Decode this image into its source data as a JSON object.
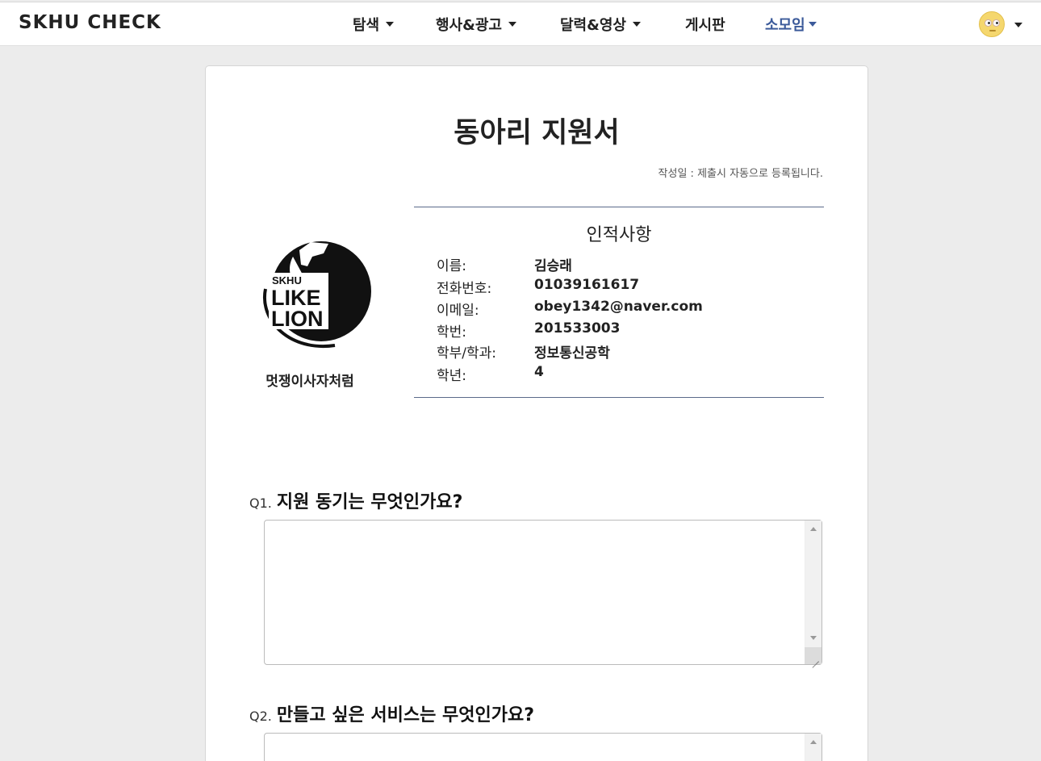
{
  "navbar": {
    "brand": "SKHU CHECK",
    "items": [
      {
        "label": "탐색",
        "dropdown": true
      },
      {
        "label": "행사&광고",
        "dropdown": true
      },
      {
        "label": "달력&영상",
        "dropdown": true
      },
      {
        "label": "게시판",
        "dropdown": false
      },
      {
        "label": "소모임",
        "dropdown": true,
        "active": true
      }
    ],
    "active_color": "#3b5a9a",
    "avatar_icon": "smiley-face-icon"
  },
  "form": {
    "title": "동아리 지원서",
    "written_date": "작성일 : 제출시 자동으로 등록됩니다.",
    "club": {
      "logo_text": [
        "SKHU",
        "LIKE",
        "LION"
      ],
      "name": "멋쟁이사자처럼"
    },
    "profile": {
      "heading": "인적사항",
      "rows": [
        {
          "key": "이름:",
          "value": "김승래"
        },
        {
          "key": "전화번호:",
          "value": "01039161617"
        },
        {
          "key": "이메일:",
          "value": "obey1342@naver.com"
        },
        {
          "key": "학번:",
          "value": "201533003"
        },
        {
          "key": "학부/학과:",
          "value": "정보통신공학"
        },
        {
          "key": "학년:",
          "value": "4"
        }
      ]
    },
    "questions": [
      {
        "number": "Q1.",
        "text": "지원 동기는 무엇인가요?",
        "answer": ""
      },
      {
        "number": "Q2.",
        "text": "만들고 싶은 서비스는 무엇인가요?",
        "answer": ""
      }
    ]
  }
}
